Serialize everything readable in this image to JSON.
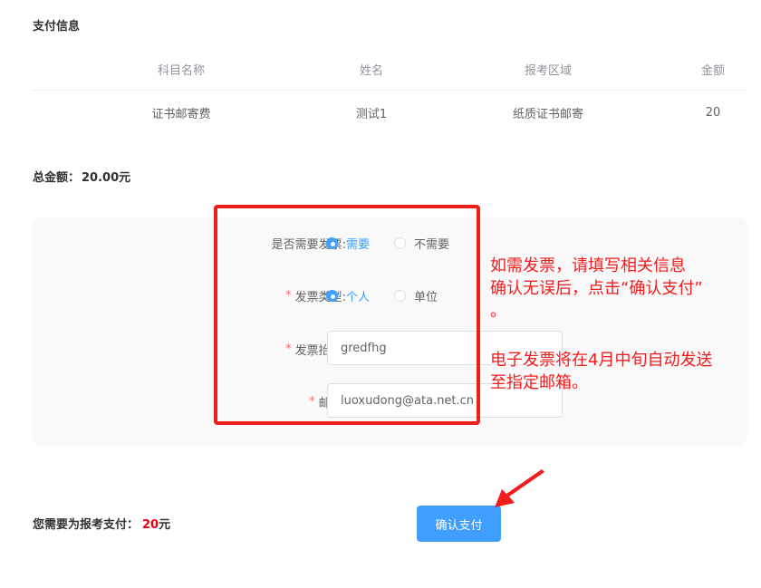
{
  "section_title": "支付信息",
  "table": {
    "headers": [
      "科目名称",
      "姓名",
      "报考区域",
      "金额"
    ],
    "rows": [
      [
        "证书邮寄费",
        "测试1",
        "纸质证书邮寄",
        "20"
      ]
    ]
  },
  "total": {
    "label": "总金额：",
    "amount": "20.00元"
  },
  "form": {
    "invoice_needed": {
      "label": "是否需要发票:",
      "options": [
        "需要",
        "不需要"
      ],
      "selected": "需要"
    },
    "invoice_type": {
      "required_mark": "*",
      "label": "发票类型:",
      "options": [
        "个人",
        "单位"
      ],
      "selected": "个人"
    },
    "invoice_title": {
      "required_mark": "*",
      "label": "发票抬头:",
      "value": "gredfhg"
    },
    "email": {
      "required_mark": "*",
      "label": "邮箱:",
      "value": "luoxudong@ata.net.cn"
    }
  },
  "annotation": {
    "lines": [
      "如需发票，请填写相关信息",
      "确认无误后，点击“确认支付”",
      "。",
      "电子发票将在4月中旬自动发送",
      "至指定邮箱。"
    ],
    "color": "#f01d1d"
  },
  "payment": {
    "label": "您需要为报考支付：",
    "amount": "20",
    "unit": "元"
  },
  "confirm_button": "确认支付",
  "colors": {
    "primary": "#409eff",
    "highlight": "#f01d1d",
    "amount": "#e60012"
  }
}
